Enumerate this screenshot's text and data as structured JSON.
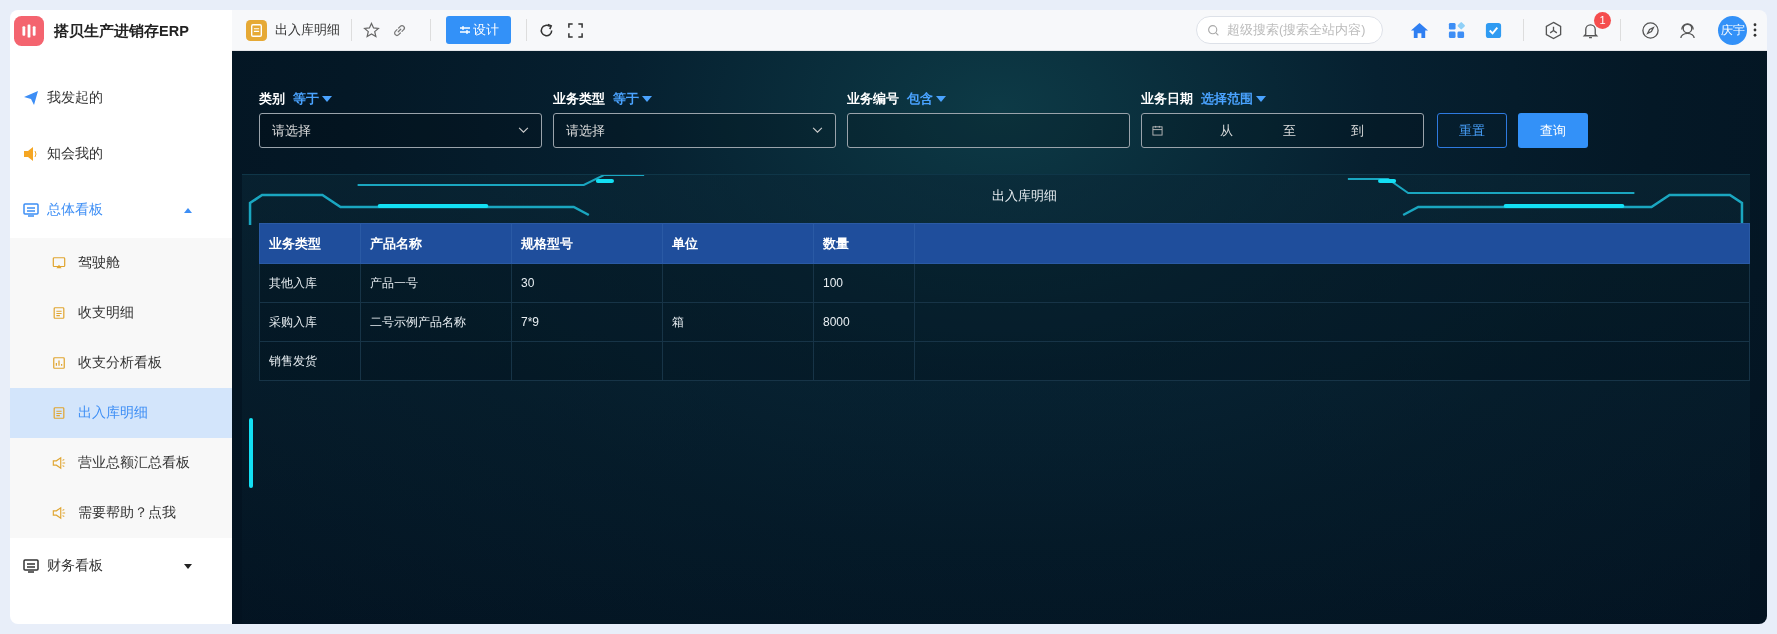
{
  "app": {
    "title": "搭贝生产进销存ERP"
  },
  "sidebar": {
    "items": [
      {
        "label": "我发起的",
        "selected": false
      },
      {
        "label": "知会我的",
        "selected": false
      },
      {
        "label": "总体看板",
        "selected": false,
        "expanded": true,
        "children": [
          {
            "label": "驾驶舱",
            "selected": false
          },
          {
            "label": "收支明细",
            "selected": false
          },
          {
            "label": "收支分析看板",
            "selected": false
          },
          {
            "label": "出入库明细",
            "selected": true
          },
          {
            "label": "营业总额汇总看板",
            "selected": false
          },
          {
            "label": "需要帮助？点我",
            "selected": false
          }
        ]
      },
      {
        "label": "财务看板",
        "selected": false,
        "expanded": false
      }
    ]
  },
  "top_bar": {
    "page_title": "出入库明细",
    "design_button": "设计",
    "search": {
      "placeholder": "超级搜索(搜索全站内容)"
    },
    "notification_count": "1",
    "avatar": "庆宇"
  },
  "filters": [
    {
      "label": "类别",
      "operator": "等于",
      "kind": "select",
      "placeholder": "请选择"
    },
    {
      "label": "业务类型",
      "operator": "等于",
      "kind": "select",
      "placeholder": "请选择"
    },
    {
      "label": "业务编号",
      "operator": "包含",
      "kind": "text"
    },
    {
      "label": "业务日期",
      "operator": "选择范围",
      "kind": "daterange",
      "from": "从",
      "sep": "至",
      "to": "到"
    }
  ],
  "buttons": {
    "reset": "重置",
    "query": "查询"
  },
  "panel": {
    "title": "出入库明细"
  },
  "table": {
    "columns": [
      "业务类型",
      "产品名称",
      "规格型号",
      "单位",
      "数量"
    ],
    "rows": [
      [
        "其他入库",
        "产品一号",
        "30",
        "",
        "100"
      ],
      [
        "采购入库",
        "二号示例产品名称",
        "7*9",
        "箱",
        "8000"
      ],
      [
        "销售发货",
        "",
        "",
        "",
        ""
      ]
    ]
  }
}
